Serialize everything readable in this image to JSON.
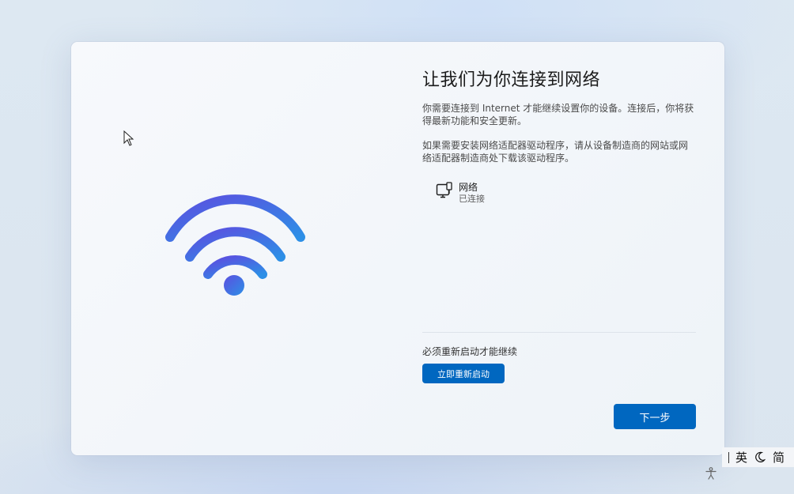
{
  "page": {
    "title": "让我们为你连接到网络",
    "paragraph1": "你需要连接到 Internet 才能继续设置你的设备。连接后，你将获得最新功能和安全更新。",
    "paragraph2": "如果需要安装网络适配器驱动程序，请从设备制造商的网站或网络适配器制造商处下载该驱动程序。"
  },
  "network": {
    "icon": "wired-network-icon",
    "name": "网络",
    "status": "已连接"
  },
  "restart": {
    "note": "必须重新启动才能继续",
    "button_label": "立即重新启动"
  },
  "footer": {
    "next_label": "下一步"
  },
  "ime_bar": {
    "language": "英",
    "mode": "简"
  },
  "colors": {
    "accent": "#0067c0",
    "wifi_start": "#5b4fe0",
    "wifi_end": "#2d8fe6"
  }
}
